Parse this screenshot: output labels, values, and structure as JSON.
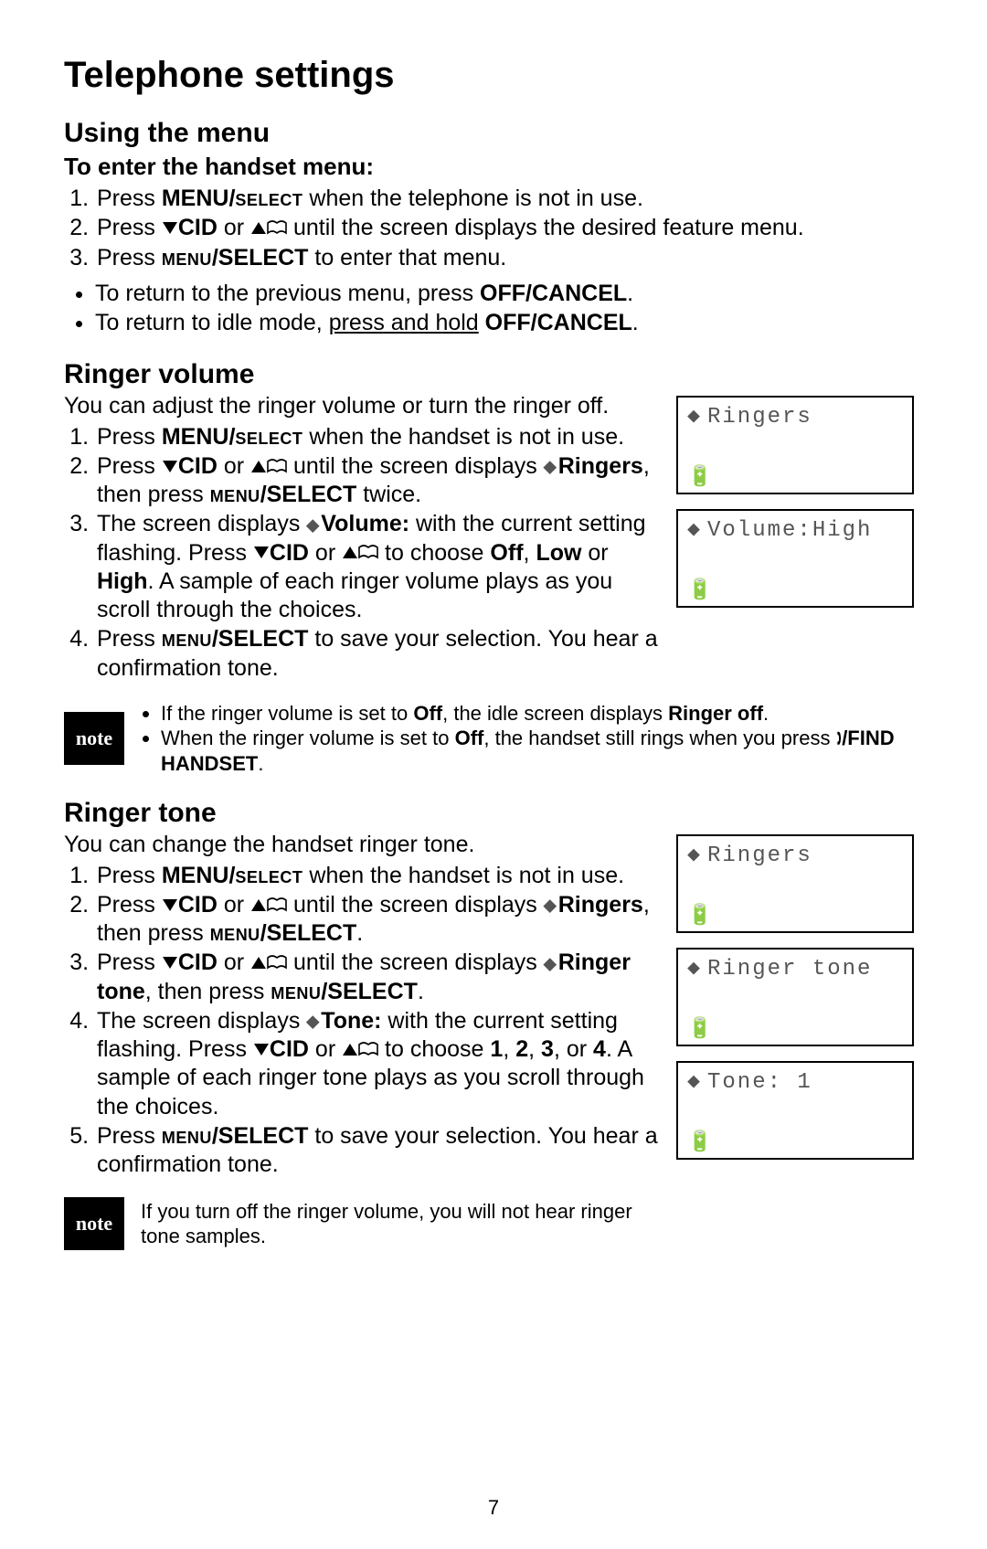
{
  "page_number": "7",
  "title": "Telephone settings",
  "using_menu": {
    "heading": "Using the menu",
    "subheading": "To enter the handset menu:",
    "steps": {
      "s1_a": "Press ",
      "s1_b": "MENU/",
      "s1_c": "select",
      "s1_d": " when the telephone is not in use.",
      "s2_a": "Press ",
      "s2_cid": "CID",
      "s2_b": " or ",
      "s2_c": " until the screen displays the desired feature menu.",
      "s3_a": "Press ",
      "s3_b": "menu",
      "s3_c": "/SELECT",
      "s3_d": " to enter that menu."
    },
    "bullets": {
      "b1_a": "To return to the previous menu, press ",
      "b1_b": "OFF/CANCEL",
      "b1_c": ".",
      "b2_a": "To return to idle mode, ",
      "b2_b": "press and hold",
      "b2_c": " ",
      "b2_d": "OFF/CANCEL",
      "b2_e": "."
    }
  },
  "ringer_volume": {
    "heading": "Ringer volume",
    "intro": "You can adjust the ringer volume or turn the ringer off.",
    "steps": {
      "s1_a": "Press ",
      "s1_b": "MENU/",
      "s1_c": "select",
      "s1_d": " when the handset is not in use.",
      "s2_a": "Press ",
      "s2_cid": "CID",
      "s2_b": " or ",
      "s2_c": " until the screen displays ",
      "s2_ringers": "Ringers",
      "s2_d": ", then press ",
      "s2_menu": "menu",
      "s2_sel": "/SELECT",
      "s2_e": " twice.",
      "s3_a": "The screen displays ",
      "s3_vol": "Volume:",
      "s3_b": " with the current setting flashing. Press ",
      "s3_cid": "CID",
      "s3_c": " or ",
      "s3_d": " to choose ",
      "s3_off": "Off",
      "s3_e": ", ",
      "s3_low": "Low",
      "s3_f": " or ",
      "s3_high": "High",
      "s3_g": ". A sample of each ringer volume plays as you scroll through the choices.",
      "s4_a": "Press ",
      "s4_menu": "menu",
      "s4_sel": "/SELECT",
      "s4_b": " to save your selection. You hear a confirmation tone."
    },
    "note": {
      "n1_a": "If the ringer volume is set to ",
      "n1_off": "Off",
      "n1_b": ", the idle screen displays ",
      "n1_ro": "Ringer off",
      "n1_c": ".",
      "n2_a": "When the ringer volume is set to ",
      "n2_off": "Off",
      "n2_b": ", the handset still rings when you press ",
      "n2_fh": "/FIND HANDSET",
      "n2_c": "."
    },
    "screens": {
      "s1": "Ringers",
      "s2": "Volume:High"
    }
  },
  "ringer_tone": {
    "heading": "Ringer tone",
    "intro": "You can change the handset ringer tone.",
    "steps": {
      "s1_a": "Press ",
      "s1_b": "MENU/",
      "s1_c": "select",
      "s1_d": " when the handset is not in use.",
      "s2_a": "Press ",
      "s2_cid": "CID",
      "s2_b": " or ",
      "s2_c": " until the screen displays ",
      "s2_ringers": "Ringers",
      "s2_d": ", then press ",
      "s2_menu": "menu",
      "s2_sel": "/SELECT",
      "s2_e": ".",
      "s3_a": "Press ",
      "s3_cid": "CID",
      "s3_b": " or ",
      "s3_c": " until the screen displays ",
      "s3_rt": "Ringer tone",
      "s3_d": ", then press ",
      "s3_menu": "menu",
      "s3_sel": "/SELECT",
      "s3_e": ".",
      "s4_a": "The screen displays ",
      "s4_tone": "Tone:",
      "s4_b": " with the current setting flashing. Press ",
      "s4_cid": "CID",
      "s4_c": " or ",
      "s4_d": " to choose ",
      "s4_1": "1",
      "s4_e1": ", ",
      "s4_2": "2",
      "s4_e2": ", ",
      "s4_3": "3",
      "s4_e3": ", or ",
      "s4_4": "4",
      "s4_e4": ". A sample of each ringer tone plays as you scroll through the choices.",
      "s5_a": "Press ",
      "s5_menu": "menu",
      "s5_sel": "/SELECT",
      "s5_b": " to save your selection. You hear a confirmation tone."
    },
    "note": "If you turn off the ringer volume, you will not hear ringer tone samples.",
    "screens": {
      "s1": "Ringers",
      "s2": "Ringer tone",
      "s3": "Tone: 1"
    }
  },
  "note_label": "note",
  "icons": {
    "battery": "🔋",
    "handset": "🕽"
  }
}
